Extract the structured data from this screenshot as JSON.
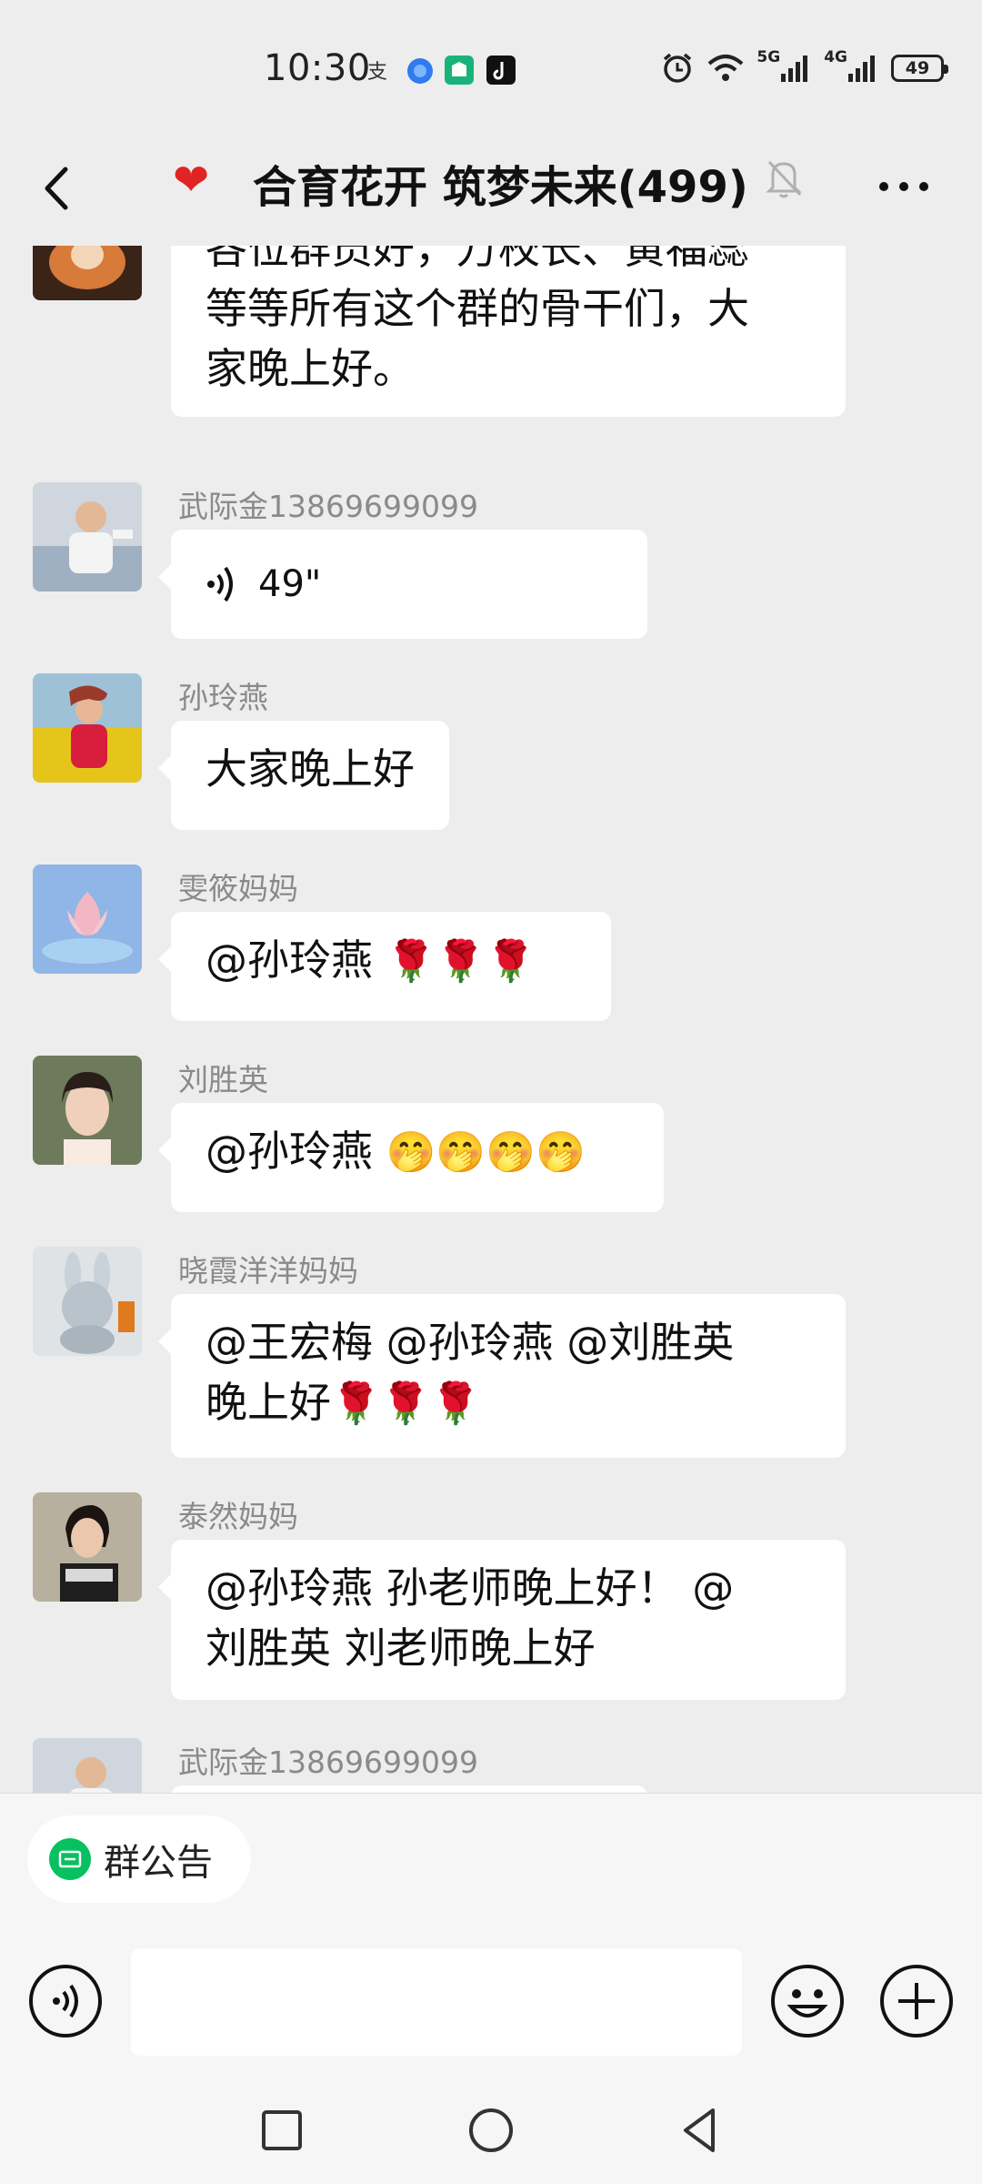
{
  "status_bar": {
    "time": "10:30",
    "net1": "5G",
    "net2": "4G",
    "battery": "49"
  },
  "header": {
    "title": "合育花开 筑梦未来(499)"
  },
  "messages": [
    {
      "sender": "",
      "lines": [
        "各位群员好，万校长、黄福蕊",
        "等等所有这个群的骨干们，大",
        "家晚上好。"
      ]
    },
    {
      "sender": "武际金13869699099",
      "voice_duration": "49\""
    },
    {
      "sender": "孙玲燕",
      "text": "大家晚上好"
    },
    {
      "sender": "雯筱妈妈",
      "text": "@孙玲燕 ",
      "emoji": "🌹🌹🌹"
    },
    {
      "sender": "刘胜英",
      "text": "@孙玲燕 ",
      "emoji": "🤭🤭🤭🤭"
    },
    {
      "sender": "晓霞洋洋妈妈",
      "line1": "@王宏梅  @孙玲燕  @刘胜英",
      "line2": " 晚上好",
      "emoji": "🌹🌹🌹"
    },
    {
      "sender": "泰然妈妈",
      "lines": [
        "@孙玲燕   孙老师晚上好！ @",
        "刘胜英   刘老师晚上好"
      ]
    },
    {
      "sender": "武际金13869699099"
    }
  ],
  "footer": {
    "notice_label": "群公告"
  },
  "colors": {
    "accent_green": "#07c160",
    "background": "#ededed",
    "bubble": "#ffffff"
  }
}
